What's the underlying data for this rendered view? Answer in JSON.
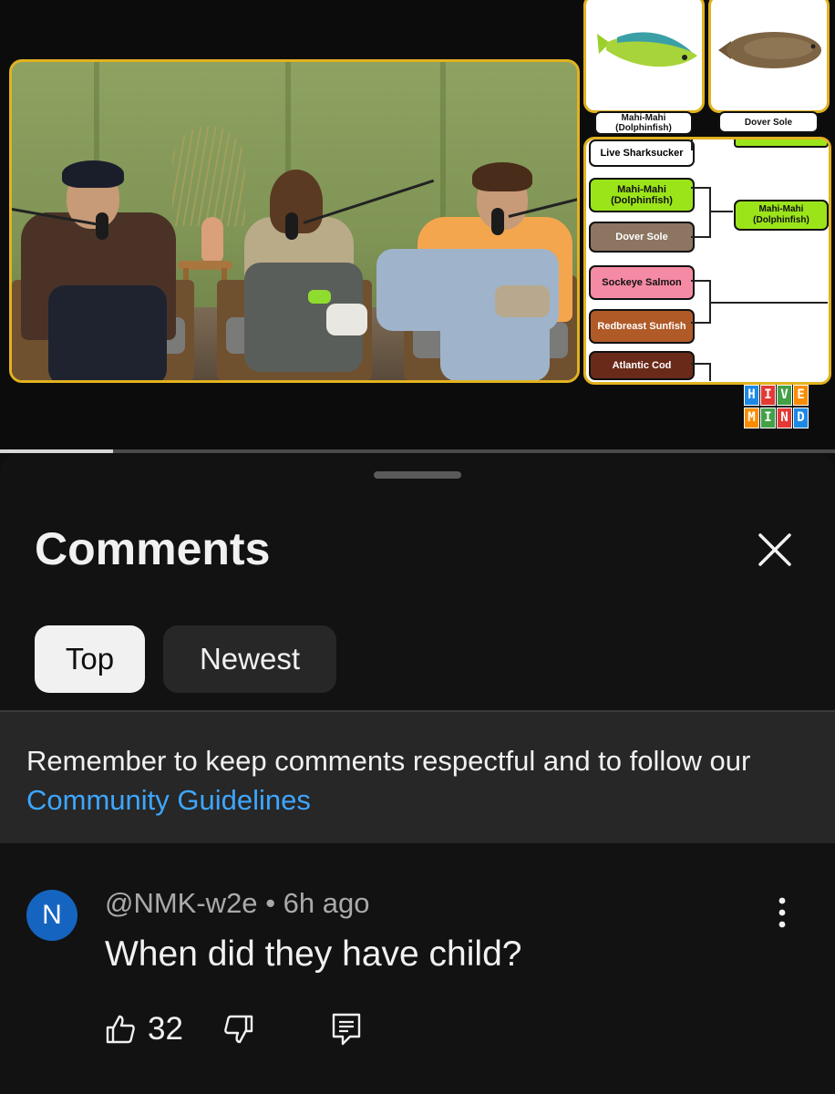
{
  "bracket": {
    "card_labels": [
      "Mahi-Mahi (Dolphinfish)",
      "Dover Sole"
    ],
    "teams": [
      {
        "label": "Live Sharksucker",
        "bg": "#ffffff",
        "fg": "#000000"
      },
      {
        "label": "Mahi-Mahi (Dolphinfish)",
        "bg": "#9be41a",
        "fg": "#111111"
      },
      {
        "label": "Dover Sole",
        "bg": "#8c7561",
        "fg": "#ffffff"
      },
      {
        "label": "Sockeye Salmon",
        "bg": "#f58aa4",
        "fg": "#111111"
      },
      {
        "label": "Redbreast Sunfish",
        "bg": "#b05a28",
        "fg": "#ffffff"
      },
      {
        "label": "Atlantic Cod",
        "bg": "#6a2a1a",
        "fg": "#ffffff"
      }
    ],
    "winner": "Mahi-Mahi (Dolphinfish)",
    "logo_letters": [
      "H",
      "I",
      "V",
      "E",
      "M",
      "I",
      "N",
      "D"
    ]
  },
  "player": {
    "progress_fraction": 0.135
  },
  "comments_panel": {
    "title": "Comments",
    "close_icon": "close-icon",
    "tabs": [
      {
        "label": "Top",
        "active": true
      },
      {
        "label": "Newest",
        "active": false
      }
    ],
    "notice": {
      "text": "Remember to keep comments respectful and to follow our ",
      "link": "Community Guidelines"
    }
  },
  "comment": {
    "avatar_letter": "N",
    "author": "@NMK-w2e",
    "separator": "•",
    "time": "6h ago",
    "text": "When did they have child?",
    "likes": "32",
    "icons": [
      "thumbs-up-icon",
      "thumbs-down-icon",
      "reply-icon",
      "more-vert-icon"
    ]
  },
  "colors": {
    "accent_link": "#3ea6ff",
    "frame_gold": "#e2b21f",
    "avatar_bg": "#1565c0",
    "sheet_bg": "#121212"
  }
}
